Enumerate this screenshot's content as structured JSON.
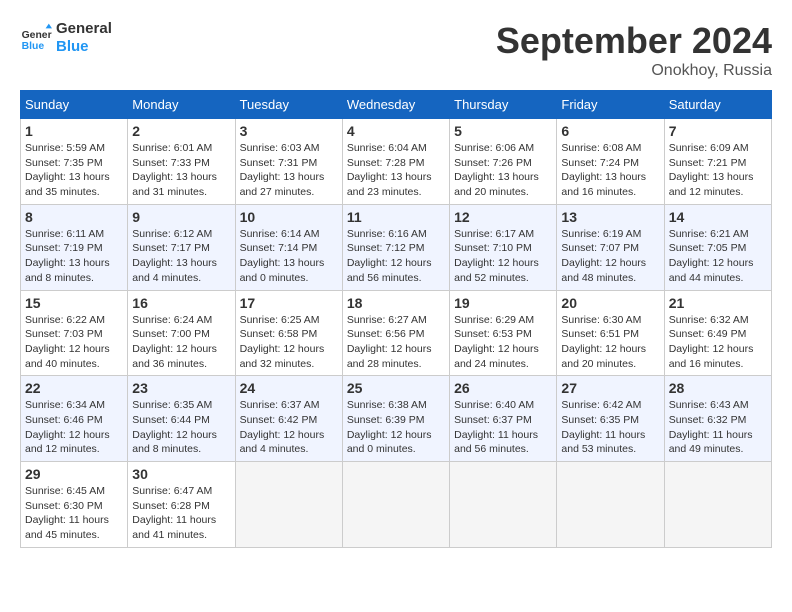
{
  "logo": {
    "line1": "General",
    "line2": "Blue"
  },
  "title": "September 2024",
  "location": "Onokhoy, Russia",
  "days_header": [
    "Sunday",
    "Monday",
    "Tuesday",
    "Wednesday",
    "Thursday",
    "Friday",
    "Saturday"
  ],
  "weeks": [
    [
      {
        "day": "1",
        "sunrise": "5:59 AM",
        "sunset": "7:35 PM",
        "daylight": "13 hours and 35 minutes."
      },
      {
        "day": "2",
        "sunrise": "6:01 AM",
        "sunset": "7:33 PM",
        "daylight": "13 hours and 31 minutes."
      },
      {
        "day": "3",
        "sunrise": "6:03 AM",
        "sunset": "7:31 PM",
        "daylight": "13 hours and 27 minutes."
      },
      {
        "day": "4",
        "sunrise": "6:04 AM",
        "sunset": "7:28 PM",
        "daylight": "13 hours and 23 minutes."
      },
      {
        "day": "5",
        "sunrise": "6:06 AM",
        "sunset": "7:26 PM",
        "daylight": "13 hours and 20 minutes."
      },
      {
        "day": "6",
        "sunrise": "6:08 AM",
        "sunset": "7:24 PM",
        "daylight": "13 hours and 16 minutes."
      },
      {
        "day": "7",
        "sunrise": "6:09 AM",
        "sunset": "7:21 PM",
        "daylight": "13 hours and 12 minutes."
      }
    ],
    [
      {
        "day": "8",
        "sunrise": "6:11 AM",
        "sunset": "7:19 PM",
        "daylight": "13 hours and 8 minutes."
      },
      {
        "day": "9",
        "sunrise": "6:12 AM",
        "sunset": "7:17 PM",
        "daylight": "13 hours and 4 minutes."
      },
      {
        "day": "10",
        "sunrise": "6:14 AM",
        "sunset": "7:14 PM",
        "daylight": "13 hours and 0 minutes."
      },
      {
        "day": "11",
        "sunrise": "6:16 AM",
        "sunset": "7:12 PM",
        "daylight": "12 hours and 56 minutes."
      },
      {
        "day": "12",
        "sunrise": "6:17 AM",
        "sunset": "7:10 PM",
        "daylight": "12 hours and 52 minutes."
      },
      {
        "day": "13",
        "sunrise": "6:19 AM",
        "sunset": "7:07 PM",
        "daylight": "12 hours and 48 minutes."
      },
      {
        "day": "14",
        "sunrise": "6:21 AM",
        "sunset": "7:05 PM",
        "daylight": "12 hours and 44 minutes."
      }
    ],
    [
      {
        "day": "15",
        "sunrise": "6:22 AM",
        "sunset": "7:03 PM",
        "daylight": "12 hours and 40 minutes."
      },
      {
        "day": "16",
        "sunrise": "6:24 AM",
        "sunset": "7:00 PM",
        "daylight": "12 hours and 36 minutes."
      },
      {
        "day": "17",
        "sunrise": "6:25 AM",
        "sunset": "6:58 PM",
        "daylight": "12 hours and 32 minutes."
      },
      {
        "day": "18",
        "sunrise": "6:27 AM",
        "sunset": "6:56 PM",
        "daylight": "12 hours and 28 minutes."
      },
      {
        "day": "19",
        "sunrise": "6:29 AM",
        "sunset": "6:53 PM",
        "daylight": "12 hours and 24 minutes."
      },
      {
        "day": "20",
        "sunrise": "6:30 AM",
        "sunset": "6:51 PM",
        "daylight": "12 hours and 20 minutes."
      },
      {
        "day": "21",
        "sunrise": "6:32 AM",
        "sunset": "6:49 PM",
        "daylight": "12 hours and 16 minutes."
      }
    ],
    [
      {
        "day": "22",
        "sunrise": "6:34 AM",
        "sunset": "6:46 PM",
        "daylight": "12 hours and 12 minutes."
      },
      {
        "day": "23",
        "sunrise": "6:35 AM",
        "sunset": "6:44 PM",
        "daylight": "12 hours and 8 minutes."
      },
      {
        "day": "24",
        "sunrise": "6:37 AM",
        "sunset": "6:42 PM",
        "daylight": "12 hours and 4 minutes."
      },
      {
        "day": "25",
        "sunrise": "6:38 AM",
        "sunset": "6:39 PM",
        "daylight": "12 hours and 0 minutes."
      },
      {
        "day": "26",
        "sunrise": "6:40 AM",
        "sunset": "6:37 PM",
        "daylight": "11 hours and 56 minutes."
      },
      {
        "day": "27",
        "sunrise": "6:42 AM",
        "sunset": "6:35 PM",
        "daylight": "11 hours and 53 minutes."
      },
      {
        "day": "28",
        "sunrise": "6:43 AM",
        "sunset": "6:32 PM",
        "daylight": "11 hours and 49 minutes."
      }
    ],
    [
      {
        "day": "29",
        "sunrise": "6:45 AM",
        "sunset": "6:30 PM",
        "daylight": "11 hours and 45 minutes."
      },
      {
        "day": "30",
        "sunrise": "6:47 AM",
        "sunset": "6:28 PM",
        "daylight": "11 hours and 41 minutes."
      },
      null,
      null,
      null,
      null,
      null
    ]
  ]
}
